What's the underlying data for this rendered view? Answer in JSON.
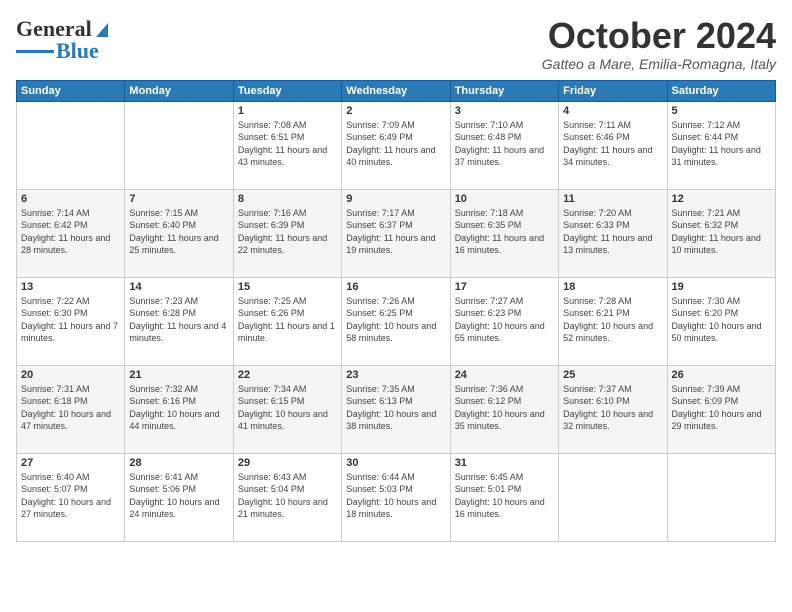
{
  "header": {
    "logo_general": "General",
    "logo_blue": "Blue",
    "title": "October 2024",
    "subtitle": "Gatteo a Mare, Emilia-Romagna, Italy"
  },
  "weekdays": [
    "Sunday",
    "Monday",
    "Tuesday",
    "Wednesday",
    "Thursday",
    "Friday",
    "Saturday"
  ],
  "weeks": [
    [
      {
        "day": "",
        "info": ""
      },
      {
        "day": "",
        "info": ""
      },
      {
        "day": "1",
        "info": "Sunrise: 7:08 AM\nSunset: 6:51 PM\nDaylight: 11 hours and 43 minutes."
      },
      {
        "day": "2",
        "info": "Sunrise: 7:09 AM\nSunset: 6:49 PM\nDaylight: 11 hours and 40 minutes."
      },
      {
        "day": "3",
        "info": "Sunrise: 7:10 AM\nSunset: 6:48 PM\nDaylight: 11 hours and 37 minutes."
      },
      {
        "day": "4",
        "info": "Sunrise: 7:11 AM\nSunset: 6:46 PM\nDaylight: 11 hours and 34 minutes."
      },
      {
        "day": "5",
        "info": "Sunrise: 7:12 AM\nSunset: 6:44 PM\nDaylight: 11 hours and 31 minutes."
      }
    ],
    [
      {
        "day": "6",
        "info": "Sunrise: 7:14 AM\nSunset: 6:42 PM\nDaylight: 11 hours and 28 minutes."
      },
      {
        "day": "7",
        "info": "Sunrise: 7:15 AM\nSunset: 6:40 PM\nDaylight: 11 hours and 25 minutes."
      },
      {
        "day": "8",
        "info": "Sunrise: 7:16 AM\nSunset: 6:39 PM\nDaylight: 11 hours and 22 minutes."
      },
      {
        "day": "9",
        "info": "Sunrise: 7:17 AM\nSunset: 6:37 PM\nDaylight: 11 hours and 19 minutes."
      },
      {
        "day": "10",
        "info": "Sunrise: 7:18 AM\nSunset: 6:35 PM\nDaylight: 11 hours and 16 minutes."
      },
      {
        "day": "11",
        "info": "Sunrise: 7:20 AM\nSunset: 6:33 PM\nDaylight: 11 hours and 13 minutes."
      },
      {
        "day": "12",
        "info": "Sunrise: 7:21 AM\nSunset: 6:32 PM\nDaylight: 11 hours and 10 minutes."
      }
    ],
    [
      {
        "day": "13",
        "info": "Sunrise: 7:22 AM\nSunset: 6:30 PM\nDaylight: 11 hours and 7 minutes."
      },
      {
        "day": "14",
        "info": "Sunrise: 7:23 AM\nSunset: 6:28 PM\nDaylight: 11 hours and 4 minutes."
      },
      {
        "day": "15",
        "info": "Sunrise: 7:25 AM\nSunset: 6:26 PM\nDaylight: 11 hours and 1 minute."
      },
      {
        "day": "16",
        "info": "Sunrise: 7:26 AM\nSunset: 6:25 PM\nDaylight: 10 hours and 58 minutes."
      },
      {
        "day": "17",
        "info": "Sunrise: 7:27 AM\nSunset: 6:23 PM\nDaylight: 10 hours and 55 minutes."
      },
      {
        "day": "18",
        "info": "Sunrise: 7:28 AM\nSunset: 6:21 PM\nDaylight: 10 hours and 52 minutes."
      },
      {
        "day": "19",
        "info": "Sunrise: 7:30 AM\nSunset: 6:20 PM\nDaylight: 10 hours and 50 minutes."
      }
    ],
    [
      {
        "day": "20",
        "info": "Sunrise: 7:31 AM\nSunset: 6:18 PM\nDaylight: 10 hours and 47 minutes."
      },
      {
        "day": "21",
        "info": "Sunrise: 7:32 AM\nSunset: 6:16 PM\nDaylight: 10 hours and 44 minutes."
      },
      {
        "day": "22",
        "info": "Sunrise: 7:34 AM\nSunset: 6:15 PM\nDaylight: 10 hours and 41 minutes."
      },
      {
        "day": "23",
        "info": "Sunrise: 7:35 AM\nSunset: 6:13 PM\nDaylight: 10 hours and 38 minutes."
      },
      {
        "day": "24",
        "info": "Sunrise: 7:36 AM\nSunset: 6:12 PM\nDaylight: 10 hours and 35 minutes."
      },
      {
        "day": "25",
        "info": "Sunrise: 7:37 AM\nSunset: 6:10 PM\nDaylight: 10 hours and 32 minutes."
      },
      {
        "day": "26",
        "info": "Sunrise: 7:39 AM\nSunset: 6:09 PM\nDaylight: 10 hours and 29 minutes."
      }
    ],
    [
      {
        "day": "27",
        "info": "Sunrise: 6:40 AM\nSunset: 5:07 PM\nDaylight: 10 hours and 27 minutes."
      },
      {
        "day": "28",
        "info": "Sunrise: 6:41 AM\nSunset: 5:06 PM\nDaylight: 10 hours and 24 minutes."
      },
      {
        "day": "29",
        "info": "Sunrise: 6:43 AM\nSunset: 5:04 PM\nDaylight: 10 hours and 21 minutes."
      },
      {
        "day": "30",
        "info": "Sunrise: 6:44 AM\nSunset: 5:03 PM\nDaylight: 10 hours and 18 minutes."
      },
      {
        "day": "31",
        "info": "Sunrise: 6:45 AM\nSunset: 5:01 PM\nDaylight: 10 hours and 16 minutes."
      },
      {
        "day": "",
        "info": ""
      },
      {
        "day": "",
        "info": ""
      }
    ]
  ]
}
